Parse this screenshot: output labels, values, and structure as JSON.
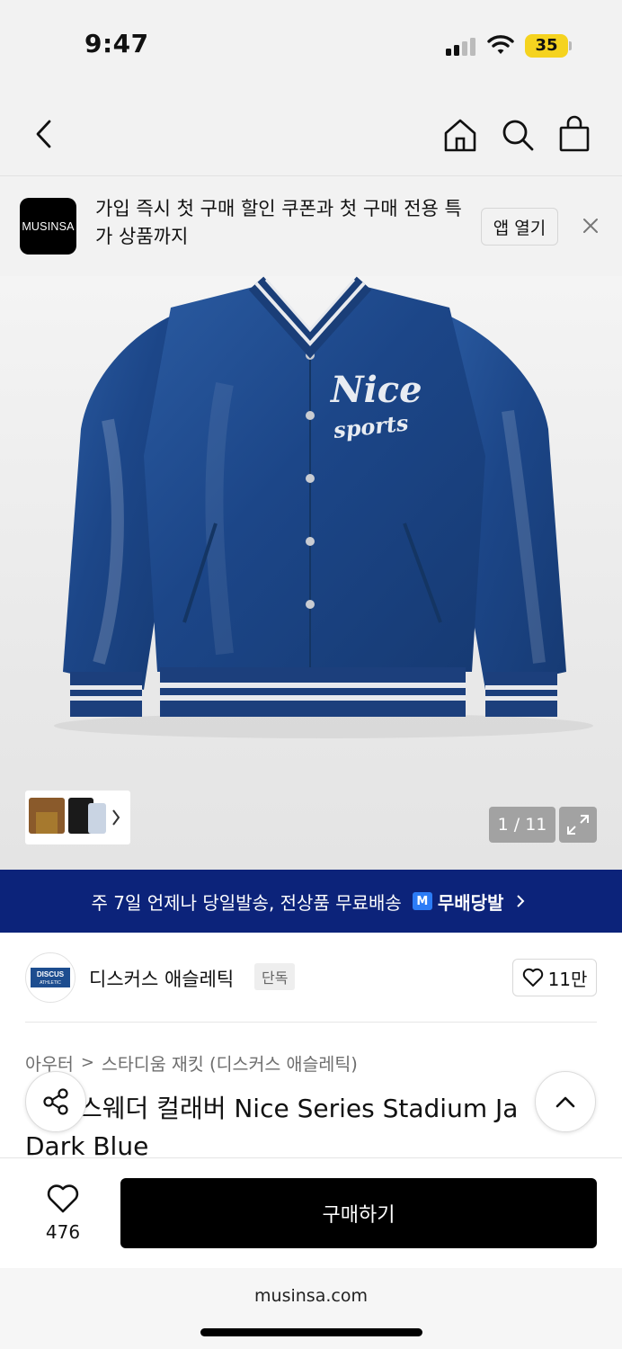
{
  "status": {
    "time": "9:47",
    "battery": "35"
  },
  "header": {
    "back_icon": "chevron-left-icon",
    "icons": [
      "home-icon",
      "search-icon",
      "shopping-bag-icon"
    ]
  },
  "app_banner": {
    "logo": "MUSINSA",
    "text": "가입 즉시 첫 구매 할인 쿠폰과 첫 구매 전용 특가 상품까지",
    "open_label": "앱 열기"
  },
  "product_image": {
    "page_indicator": "1 / 11",
    "chest_text_line1": "Nice",
    "chest_text_line2": "sports"
  },
  "shipping_banner": {
    "text": "주 7일 언제나 당일발송, 전상품 무료배송",
    "badge_mark": "M",
    "badge_label": "무배당발"
  },
  "brand": {
    "logo_text": "DISCUS",
    "logo_subtext": "ATHLETIC",
    "name": "디스커스 애슬레틱",
    "tag": "단독",
    "likes": "11만"
  },
  "breadcrumb": {
    "category": "아우터",
    "subcategory": "스타디움 재킷 (디스커스 애슬레틱)"
  },
  "product": {
    "title_line1": "스웨더 컬래버 Nice Series Stadium Ja",
    "title_line2": "Dark Blue"
  },
  "bottom_bar": {
    "wish_count": "476",
    "buy_label": "구매하기"
  },
  "browser": {
    "url": "musinsa.com"
  },
  "colors": {
    "shipping_banner_bg": "#0c237a",
    "jacket_blue": "#1f4b8c",
    "buy_button": "#000000",
    "battery": "#f5d31f"
  }
}
